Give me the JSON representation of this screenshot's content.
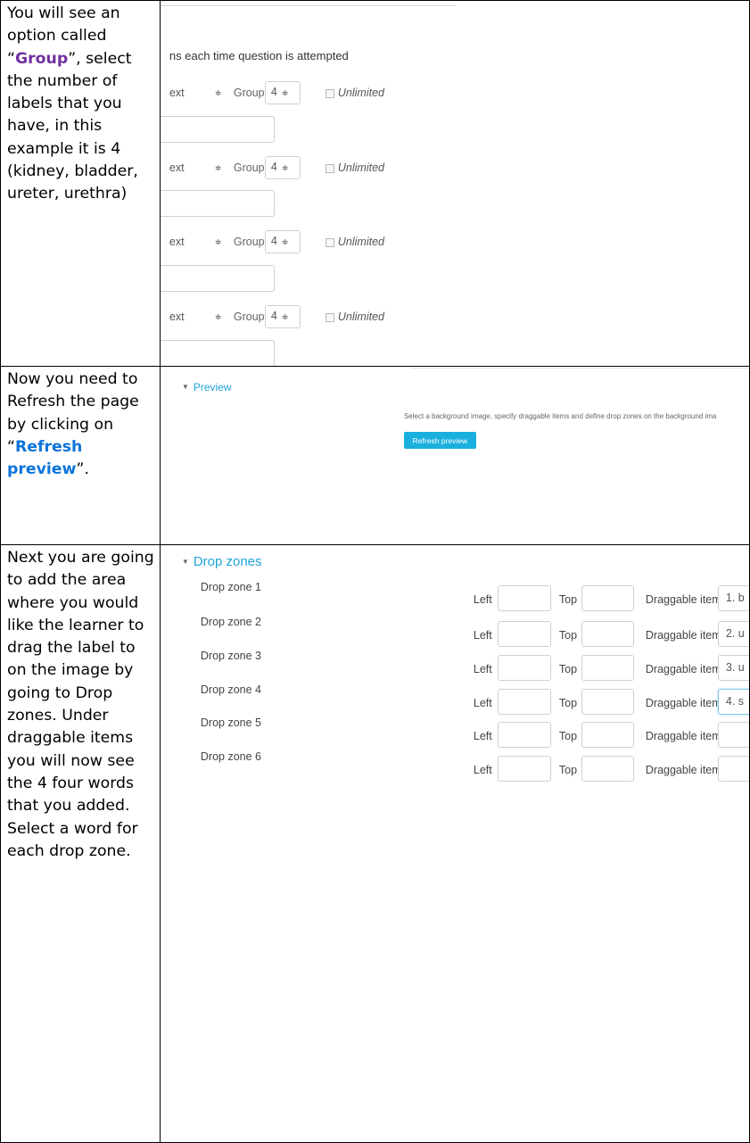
{
  "instructions": {
    "row1": {
      "before": " You will see an option called “",
      "keyword": "Group",
      "after": "”, select the number of labels that you have, in this example it is 4 (kidney, bladder, ureter, urethra)"
    },
    "row2": {
      "before": "Now you need to Refresh the page by clicking on “",
      "keyword": "Refresh preview",
      "after": "”."
    },
    "row3": {
      "text": "Next you are going to add the area where you would like the learner to drag the label to on the image by going to Drop zones. Under draggable items you will now see the 4 four words that you added. Select a word for each drop zone."
    }
  },
  "group_panel": {
    "header": "ns each time question is attempted",
    "rows": [
      {
        "type_fragment": "ext",
        "group_label": "Group",
        "group_value": "4",
        "unlimited_label": "Unlimited"
      },
      {
        "type_fragment": "ext",
        "group_label": "Group",
        "group_value": "4",
        "unlimited_label": "Unlimited"
      },
      {
        "type_fragment": "ext",
        "group_label": "Group",
        "group_value": "4",
        "unlimited_label": "Unlimited"
      },
      {
        "type_fragment": "ext",
        "group_label": "Group",
        "group_value": "4",
        "unlimited_label": "Unlimited"
      }
    ],
    "select_arrow": "≑"
  },
  "preview_panel": {
    "section_title": "Preview",
    "description": "Select a background image, specify draggable items and define drop zones on the background ima",
    "refresh_button": "Refresh preview"
  },
  "dropzones_panel": {
    "section_title": "Drop zones",
    "left_label": "Left",
    "top_label": "Top",
    "draggable_label": "Draggable item",
    "zones": [
      {
        "name": "Drop zone 1",
        "item": "1. b"
      },
      {
        "name": "Drop zone 2",
        "item": "2. u"
      },
      {
        "name": "Drop zone 3",
        "item": "3. u"
      },
      {
        "name": "Drop zone 4",
        "item": "4. s"
      },
      {
        "name": "Drop zone 5",
        "item": ""
      },
      {
        "name": "Drop zone 6",
        "item": ""
      }
    ]
  },
  "colors": {
    "group_keyword": "#7030a0",
    "refresh_keyword": "#0b74d9",
    "section_heading": "#1fa2d6",
    "refresh_button_bg": "#1ab0de"
  }
}
